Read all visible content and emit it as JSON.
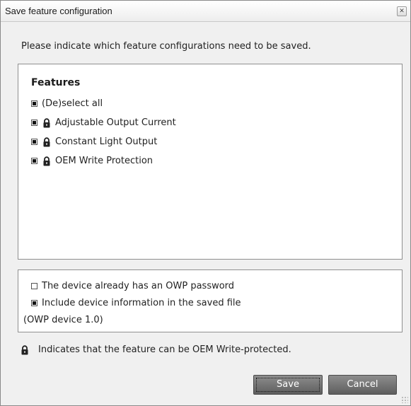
{
  "window": {
    "title": "Save feature configuration",
    "close_glyph": "✕"
  },
  "instruction": "Please indicate which feature configurations need to be saved.",
  "features": {
    "heading": "Features",
    "items": [
      {
        "label": "(De)select all",
        "checked": true,
        "locked": false
      },
      {
        "label": "Adjustable Output Current",
        "checked": true,
        "locked": true
      },
      {
        "label": "Constant Light Output",
        "checked": true,
        "locked": true
      },
      {
        "label": "OEM Write Protection",
        "checked": true,
        "locked": true
      }
    ]
  },
  "options": {
    "owp_password": {
      "label": "The device already has an OWP password",
      "checked": false
    },
    "include_device_info": {
      "label": "Include device information in the saved file",
      "checked": true
    },
    "device_info": "(OWP device 1.0)"
  },
  "note": "Indicates that the feature can be OEM Write-protected.",
  "buttons": {
    "save": "Save",
    "cancel": "Cancel"
  },
  "icons": {
    "lock": "lock-icon",
    "close": "close-icon",
    "resize": "resize-grip-icon"
  }
}
